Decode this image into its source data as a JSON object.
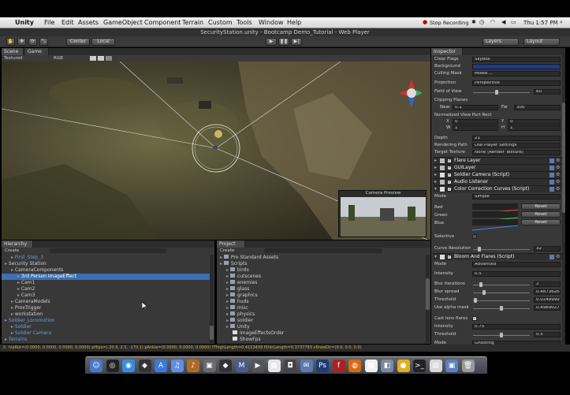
{
  "menubar": {
    "apple_icon": "apple-icon",
    "items": [
      "Unity",
      "File",
      "Edit",
      "Assets",
      "GameObject",
      "Component",
      "Terrain",
      "Custom",
      "Tools",
      "Window",
      "Help"
    ],
    "status_stop_recording": "Stop Recording",
    "clock": "Thu 1:57 PM"
  },
  "window": {
    "title": "SecurityStation.unity - Bootcamp Demo_Tutorial - Web Player"
  },
  "toolbar": {
    "pivot_label": "Center",
    "space_label": "Local",
    "layers_label": "Layers",
    "layout_label": "Layout"
  },
  "scene": {
    "tab_scene": "Scene",
    "tab_game": "Game",
    "render_mode": "Textured",
    "color_mode": "RGB",
    "camera_preview_title": "Camera Preview"
  },
  "hierarchy": {
    "tab": "Hierarchy",
    "create_label": "Create",
    "items": [
      {
        "label": "First_Step_3",
        "indent": 1,
        "prefab": true,
        "selected": false
      },
      {
        "label": "Security Station",
        "indent": 0,
        "prefab": false,
        "selected": false
      },
      {
        "label": "CameraComponents",
        "indent": 1,
        "prefab": false,
        "selected": false
      },
      {
        "label": "3rd Person ImageEffect",
        "indent": 2,
        "prefab": false,
        "selected": true
      },
      {
        "label": "Cam1",
        "indent": 2,
        "prefab": false,
        "selected": false
      },
      {
        "label": "Cam2",
        "indent": 2,
        "prefab": false,
        "selected": false
      },
      {
        "label": "Cam3",
        "indent": 2,
        "prefab": false,
        "selected": false
      },
      {
        "label": "CameraModels",
        "indent": 1,
        "prefab": false,
        "selected": false
      },
      {
        "label": "ProxTrigger",
        "indent": 1,
        "prefab": false,
        "selected": false
      },
      {
        "label": "workstation",
        "indent": 1,
        "prefab": false,
        "selected": false
      },
      {
        "label": "Soldier_Locomotion",
        "indent": 0,
        "prefab": true,
        "selected": false
      },
      {
        "label": "Soldier",
        "indent": 1,
        "prefab": true,
        "selected": false
      },
      {
        "label": "Soldier Camera",
        "indent": 1,
        "prefab": true,
        "selected": false
      },
      {
        "label": "Terrains",
        "indent": 0,
        "prefab": true,
        "selected": false
      }
    ]
  },
  "project": {
    "tab": "Project",
    "create_label": "Create",
    "items": [
      {
        "label": "Pro Standard Assets",
        "indent": 0
      },
      {
        "label": "Scripts",
        "indent": 0
      },
      {
        "label": "birds",
        "indent": 1
      },
      {
        "label": "cutscenes",
        "indent": 1
      },
      {
        "label": "enemies",
        "indent": 1
      },
      {
        "label": "glass",
        "indent": 1
      },
      {
        "label": "graphics",
        "indent": 1
      },
      {
        "label": "huds",
        "indent": 1
      },
      {
        "label": "misc",
        "indent": 1
      },
      {
        "label": "physics",
        "indent": 1
      },
      {
        "label": "soldier",
        "indent": 1
      },
      {
        "label": "Unity",
        "indent": 1
      },
      {
        "label": "ImageEffectsOrder",
        "indent": 2
      },
      {
        "label": "ShowFps",
        "indent": 2
      }
    ]
  },
  "inspector": {
    "tab": "Inspector",
    "camera_props": [
      {
        "label": "Clear Flags",
        "value": "Skybox"
      },
      {
        "label": "Background",
        "value": ""
      },
      {
        "label": "Culling Mask",
        "value": "Mixed ..."
      },
      {
        "label": "Projection",
        "value": "Perspective"
      },
      {
        "label": "Field of View",
        "value": "60"
      }
    ],
    "clipping_planes_label": "Clipping Planes",
    "near_label": "Near",
    "near_value": "0.1",
    "far_label": "Far",
    "far_value": "300",
    "viewport_label": "Normalized View Port Rect",
    "vp_x_label": "X",
    "vp_x": "0",
    "vp_y_label": "Y",
    "vp_y": "0",
    "vp_w_label": "W",
    "vp_w": "1",
    "vp_h_label": "H",
    "vp_h": "1",
    "depth_label": "Depth",
    "depth_value": "21",
    "rendering_path_label": "Rendering Path",
    "rendering_path_value": "Use Player Settings",
    "target_texture_label": "Target Texture",
    "target_texture_value": "None (Render Texture)",
    "components": [
      {
        "label": "Flare Layer",
        "checked": true
      },
      {
        "label": "GUILayer",
        "checked": true
      },
      {
        "label": "Soldier Camera (Script)",
        "checked": true
      },
      {
        "label": "Audio Listener",
        "checked": true
      },
      {
        "label": "Color Correction Curves (Script)",
        "checked": true
      }
    ],
    "cc_mode_label": "Mode",
    "cc_mode_value": "Simple",
    "cc_red_label": "Red",
    "cc_green_label": "Green",
    "cc_blue_label": "Blue",
    "reset_label": "Reset",
    "selective_label": "Selective",
    "curve_resolution_label": "Curve Resolution",
    "curve_resolution_value": "32",
    "bloom_component": "Bloom And Flares (Script)",
    "bloom_mode_label": "Mode",
    "bloom_mode_value": "Advanced",
    "intensity_label": "Intensity",
    "intensity_value": "0.5",
    "iterations_label": "Blur iterations",
    "iterations_value": "2",
    "blur_spread_label": "Blur spread",
    "blur_spread_value": "0.4873626",
    "threshold_label": "Threshold",
    "threshold_value": "0.02499996",
    "use_alpha_label": "Use alpha mask",
    "use_alpha_value": "0.4989027",
    "cast_lens_label": "Cast lens flares",
    "lens_intensity_label": "Intensity",
    "lens_intensity_value": "0.75",
    "lens_threshold_label": "Threshold",
    "lens_threshold_value": "0.5",
    "lens_mode_label": "Mode",
    "lens_mode_value": "Ghosting"
  },
  "statusbar": {
    "text": "hipRot=(0.0000, 0.0000, 0.0000, 0.0000) pHips=(-20.9, 2.5, -170.1) pAnkle=(0.0000, 0.0000, 0.0000) fThighLength=0.4153409 fShinLength=0.3737793 vKneeDir=(0.0, 0.0, 0.0)"
  },
  "dock": {
    "icons": [
      "finder-icon",
      "dashboard-icon",
      "safari-icon",
      "unity-icon",
      "appstore-icon",
      "itunes-icon",
      "guitar-icon",
      "photos-icon",
      "unity-icon",
      "monodevelop-icon",
      "movie-icon",
      "calendar-icon",
      "camera-icon",
      "mail-icon",
      "photoshop-icon",
      "flash-icon",
      "firefox-icon",
      "ical-icon",
      "preview-icon",
      "adium-icon",
      "terminal-icon",
      "documents-icon",
      "folder-icon",
      "trash-icon"
    ]
  },
  "colors": {
    "accent_blue": "#3b6fb0",
    "prefab_blue": "#6a9edc",
    "panel": "#383838"
  }
}
